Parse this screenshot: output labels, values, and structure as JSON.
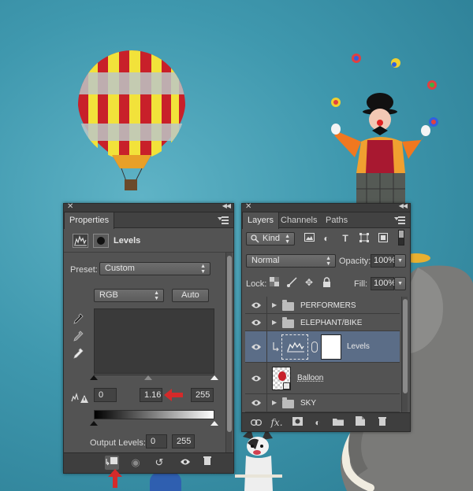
{
  "properties_panel": {
    "tab": "Properties",
    "title": "Levels",
    "preset_label": "Preset:",
    "preset_value": "Custom",
    "channel_value": "RGB",
    "auto_label": "Auto",
    "input_black": "0",
    "input_gamma": "1.16",
    "input_white": "255",
    "output_label": "Output Levels:",
    "output_black": "0",
    "output_white": "255"
  },
  "layers_panel": {
    "tabs": [
      "Layers",
      "Channels",
      "Paths"
    ],
    "filter_kind": "Kind",
    "blend_mode": "Normal",
    "opacity_label": "Opacity:",
    "opacity_value": "100%",
    "lock_label": "Lock:",
    "fill_label": "Fill:",
    "fill_value": "100%",
    "layers": [
      {
        "name": "PERFORMERS",
        "type": "group",
        "selected": false
      },
      {
        "name": "ELEPHANT/BIKE",
        "type": "group",
        "selected": false
      },
      {
        "name": "Levels",
        "type": "adjustment",
        "selected": true
      },
      {
        "name": "Balloon",
        "type": "smart-object",
        "selected": false
      },
      {
        "name": "SKY",
        "type": "group",
        "selected": false
      }
    ],
    "footer_fx": "fx."
  },
  "colors": {
    "panel_bg": "#535353",
    "selected_row": "#5b6d87",
    "annotation_red": "#d42a2a"
  }
}
